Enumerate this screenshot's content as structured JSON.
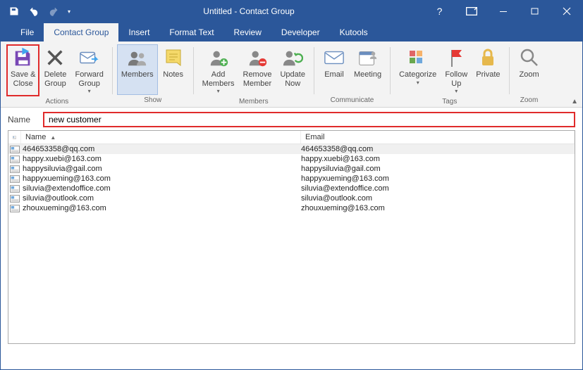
{
  "titlebar": {
    "title": "Untitled -  Contact Group"
  },
  "tabs": {
    "file": "File",
    "contact_group": "Contact Group",
    "insert": "Insert",
    "format_text": "Format Text",
    "review": "Review",
    "developer": "Developer",
    "kutools": "Kutools"
  },
  "ribbon": {
    "save_close": "Save &\nClose",
    "delete_group": "Delete\nGroup",
    "forward_group": "Forward\nGroup",
    "actions_label": "Actions",
    "members": "Members",
    "notes": "Notes",
    "show_label": "Show",
    "add_members": "Add\nMembers",
    "remove_member": "Remove\nMember",
    "update_now": "Update\nNow",
    "members_label": "Members",
    "email": "Email",
    "meeting": "Meeting",
    "communicate_label": "Communicate",
    "categorize": "Categorize",
    "follow_up": "Follow\nUp",
    "private": "Private",
    "tags_label": "Tags",
    "zoom": "Zoom",
    "zoom_label": "Zoom"
  },
  "name_row": {
    "label": "Name",
    "value": "new customer"
  },
  "list": {
    "headers": {
      "name": "Name",
      "email": "Email"
    },
    "rows": [
      {
        "name": "464653358@qq.com",
        "email": "464653358@qq.com",
        "selected": true
      },
      {
        "name": "happy.xuebi@163.com",
        "email": "happy.xuebi@163.com",
        "selected": false
      },
      {
        "name": "happysiluvia@gail.com",
        "email": "happysiluvia@gail.com",
        "selected": false
      },
      {
        "name": "happyxueming@163.com",
        "email": "happyxueming@163.com",
        "selected": false
      },
      {
        "name": "siluvia@extendoffice.com",
        "email": "siluvia@extendoffice.com",
        "selected": false
      },
      {
        "name": "siluvia@outlook.com",
        "email": "siluvia@outlook.com",
        "selected": false
      },
      {
        "name": "zhouxueming@163.com",
        "email": "zhouxueming@163.com",
        "selected": false
      }
    ]
  }
}
